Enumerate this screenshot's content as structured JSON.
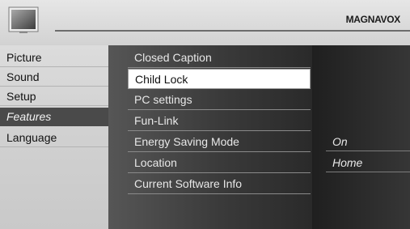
{
  "brand": "MAGNAVOX",
  "header_icon": "tv-screen-icon",
  "main_menu": {
    "items": [
      {
        "label": "Picture"
      },
      {
        "label": "Sound"
      },
      {
        "label": "Setup"
      },
      {
        "label": "Features",
        "selected": true
      },
      {
        "label": "Language"
      }
    ]
  },
  "features_menu": {
    "items": [
      {
        "label": "Closed Caption"
      },
      {
        "label": "Child Lock",
        "highlighted": true
      },
      {
        "label": "PC settings"
      },
      {
        "label": "Fun-Link"
      },
      {
        "label": "Energy Saving Mode"
      },
      {
        "label": "Location"
      },
      {
        "label": "Current Software Info"
      }
    ]
  },
  "values": {
    "energy_saving_mode": "On",
    "location": "Home"
  },
  "colors": {
    "selected_bg": "#4a4a4a",
    "highlight_bg": "#ffffff"
  }
}
